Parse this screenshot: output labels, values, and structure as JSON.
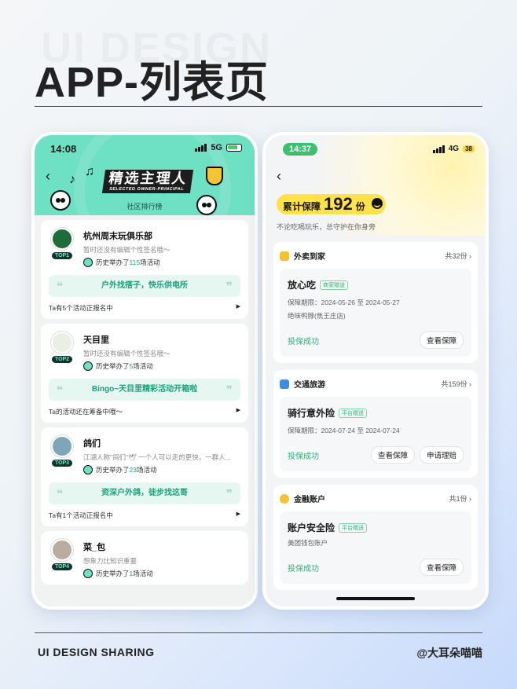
{
  "page": {
    "watermark": "UI DESIGN",
    "title": "APP-列表页",
    "footer_left": "UI DESIGN SHARING",
    "footer_right": "@大耳朵喵喵"
  },
  "left_phone": {
    "status_time": "14:08",
    "network": "5G",
    "logo_text": "精选主理人",
    "logo_sub": "SELECTED OWNER-PRINCIPAL",
    "subtitle": "社区排行榜",
    "clubs": [
      {
        "name": "杭州周末玩俱乐部",
        "rank": "TOP1",
        "desc": "暂时还没有编辑个性签名哦～",
        "hist_prefix": "历史举办了",
        "hist_num": "115",
        "hist_suffix": "场活动",
        "banner": "户外找搭子，快乐供电所",
        "footer": "Ta有5个活动正报名中",
        "avatar_color": "#1f6b3a"
      },
      {
        "name": "天目里",
        "rank": "TOP2",
        "desc": "暂时还没有编辑个性签名哦～",
        "hist_prefix": "历史举办了",
        "hist_num": "5",
        "hist_suffix": "场活动",
        "banner": "Bingo~天目里精彩活动开箱啦",
        "footer": "Ta的活动还在筹备中哦～",
        "avatar_color": "#e9efe4"
      },
      {
        "name": "鸽们",
        "rank": "TOP3",
        "desc": "江湖人称\"鸽们\"🕊 一个人可以走的更快，一群人...",
        "hist_prefix": "历史举办了",
        "hist_num": "23",
        "hist_suffix": "场活动",
        "banner": "资深户外鸽，徒步找这哥",
        "footer": "Ta有1个活动正报名中",
        "avatar_color": "#7fa6b8"
      },
      {
        "name": "菜_包",
        "rank": "TOP4",
        "desc": "想象力比知识重要",
        "hist_prefix": "历史举办了",
        "hist_num": "1",
        "hist_suffix": "场活动",
        "avatar_color": "#b9ada0"
      }
    ]
  },
  "right_phone": {
    "status_time": "14:37",
    "network": "4G",
    "battery": "38",
    "total_label_pre": "累计保障",
    "total_num": "192",
    "total_label_post": "份",
    "slogan": "不论吃喝玩乐，总守护在你身旁",
    "categories": [
      {
        "title": "外卖到家",
        "count": "共32份",
        "icon_color": "#f2c230",
        "policy": {
          "name": "放心吃",
          "tag": "商家赠送",
          "period": "保障期限：2024-05-26 至 2024-05-27",
          "shop": "绝味鸭脖(焦王庄店)",
          "status": "投保成功",
          "buttons": [
            "查看保障"
          ]
        }
      },
      {
        "title": "交通旅游",
        "count": "共159份",
        "icon_color": "#3b8de0",
        "policy": {
          "name": "骑行意外险",
          "tag": "平台赠送",
          "period": "保障期限：2024-07-24 至 2024-07-24",
          "shop": "",
          "status": "投保成功",
          "buttons": [
            "查看保障",
            "申请理赔"
          ]
        }
      },
      {
        "title": "金融账户",
        "count": "共1份",
        "icon_color": "#f2c230",
        "policy": {
          "name": "账户安全险",
          "tag": "平台赠送",
          "period": "",
          "shop": "美团钱包账户",
          "status": "投保成功",
          "buttons": [
            "查看保障"
          ]
        }
      }
    ]
  }
}
